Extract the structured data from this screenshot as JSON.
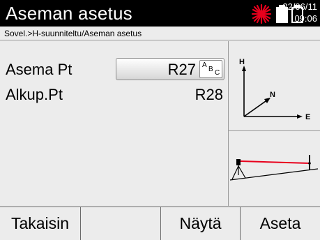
{
  "header": {
    "title": "Aseman asetus",
    "date": "22/06/11",
    "time": "09:06",
    "icons": [
      "laser-icon",
      "battery-full-icon",
      "battery-empty-icon"
    ],
    "laser_color": "#e8001c"
  },
  "breadcrumb": "Sovel.>H-suunniteltu/Aseman asetus",
  "form": {
    "station_label": "Asema Pt",
    "station_value": "R27",
    "input_mode_glyphs": [
      "A",
      "B",
      "C"
    ],
    "origin_label": "Alkup.Pt",
    "origin_value": "R28"
  },
  "diagram": {
    "axis_h": "H",
    "axis_n": "N",
    "axis_e": "E"
  },
  "softkeys": {
    "back": "Takaisin",
    "empty": "",
    "show": "Näytä",
    "set": "Aseta"
  }
}
